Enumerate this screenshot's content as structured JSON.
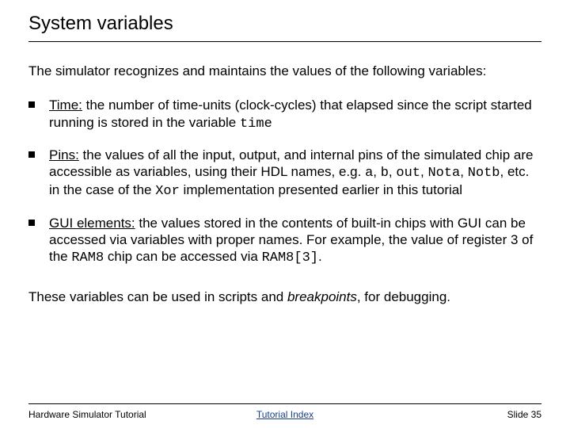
{
  "title": "System variables",
  "intro": "The simulator recognizes and maintains the values of the following variables:",
  "bullets": {
    "time": {
      "label": "Time:",
      "t1": " the number of time-units (clock-cycles) that elapsed since the script started running is stored in the variable ",
      "code1": "time"
    },
    "pins": {
      "label": "Pins:",
      "t1": " the values of all the input, output, and internal pins of the simulated chip are accessible as variables, using their HDL names, e.g. ",
      "code1": "a",
      "c1": ", ",
      "code2": "b",
      "c2": ", ",
      "code3": "out",
      "c3": ", ",
      "code4": "Nota",
      "c4": ", ",
      "code5": "Notb",
      "t2": ", etc. in the case of the ",
      "code6": "Xor",
      "t3": " implementation presented earlier in this tutorial"
    },
    "gui": {
      "label": "GUI elements:",
      "t1": " the values stored in the contents of built-in chips with GUI can be accessed via variables with proper names.  For example, the value of register 3 of the ",
      "code1": "RAM8",
      "t2": " chip can be accessed via ",
      "code2": "RAM8[3]",
      "t3": "."
    }
  },
  "outro": {
    "t1": "These variables can be used in scripts and ",
    "ital": "breakpoints",
    "t2": ", for debugging."
  },
  "footer": {
    "left": "Hardware Simulator Tutorial",
    "center": "Tutorial Index",
    "right": "Slide 35"
  }
}
